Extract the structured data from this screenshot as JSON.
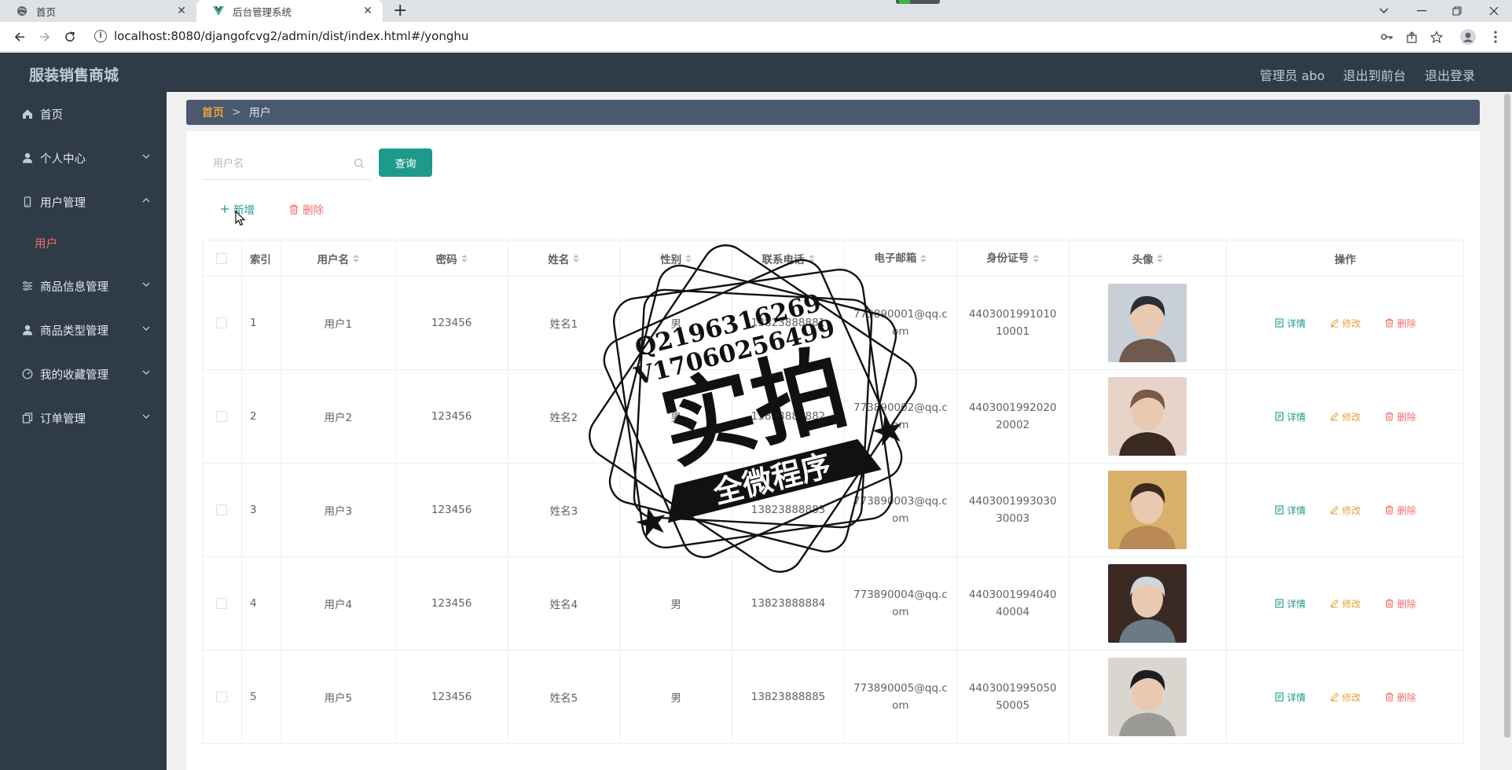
{
  "browser": {
    "tabs": [
      {
        "title": "首页",
        "active": false
      },
      {
        "title": "后台管理系统",
        "active": true
      }
    ],
    "close_glyph": "✕",
    "new_tab_glyph": "+",
    "url": "localhost:8080/djangofcvg2/admin/dist/index.html#/yonghu"
  },
  "header": {
    "brand": "服装销售商城",
    "admin_label": "管理员 abo",
    "to_front": "退出到前台",
    "logout": "退出登录"
  },
  "sidebar": {
    "items": [
      {
        "label": "首页",
        "icon": "home-icon"
      },
      {
        "label": "个人中心",
        "icon": "user-icon"
      },
      {
        "label": "用户管理",
        "icon": "phone-icon"
      },
      {
        "label": "用户",
        "icon": ""
      },
      {
        "label": "商品信息管理",
        "icon": "sliders-icon"
      },
      {
        "label": "商品类型管理",
        "icon": "user-icon"
      },
      {
        "label": "我的收藏管理",
        "icon": "gauge-icon"
      },
      {
        "label": "订单管理",
        "icon": "copy-icon"
      }
    ]
  },
  "breadcrumb": {
    "home": "首页",
    "separator": ">",
    "current": "用户"
  },
  "search": {
    "placeholder": "用户名",
    "value": "",
    "button": "查询"
  },
  "actions": {
    "add": "新增",
    "delete": "删除"
  },
  "table": {
    "columns": [
      "索引",
      "用户名",
      "密码",
      "姓名",
      "性别",
      "联系电话",
      "电子邮箱",
      "身份证号",
      "头像",
      "操作"
    ],
    "rows": [
      {
        "index": "1",
        "username": "用户1",
        "password": "123456",
        "name": "姓名1",
        "sex": "男",
        "phone": "13823888881",
        "email": "773890001@qq.com",
        "idcard": "440300199101010001"
      },
      {
        "index": "2",
        "username": "用户2",
        "password": "123456",
        "name": "姓名2",
        "sex": "男",
        "phone": "13823888882",
        "email": "773890002@qq.com",
        "idcard": "440300199202020002"
      },
      {
        "index": "3",
        "username": "用户3",
        "password": "123456",
        "name": "姓名3",
        "sex": "男",
        "phone": "13823888883",
        "email": "773890003@qq.com",
        "idcard": "440300199303030003"
      },
      {
        "index": "4",
        "username": "用户4",
        "password": "123456",
        "name": "姓名4",
        "sex": "男",
        "phone": "13823888884",
        "email": "773890004@qq.com",
        "idcard": "440300199404040004"
      },
      {
        "index": "5",
        "username": "用户5",
        "password": "123456",
        "name": "姓名5",
        "sex": "男",
        "phone": "13823888885",
        "email": "773890005@qq.com",
        "idcard": "440300199505050005"
      }
    ],
    "ops": {
      "detail": "详情",
      "edit": "修改",
      "delete": "删除"
    }
  },
  "watermark": {
    "line1": "Q2196316269",
    "line2": "V17060256499",
    "main": "实拍",
    "banner": "全微程序"
  },
  "colors": {
    "header_bg": "#2f3b47",
    "accent": "#1d9a8a",
    "danger": "#f56c6c",
    "warning": "#e6a23c"
  }
}
